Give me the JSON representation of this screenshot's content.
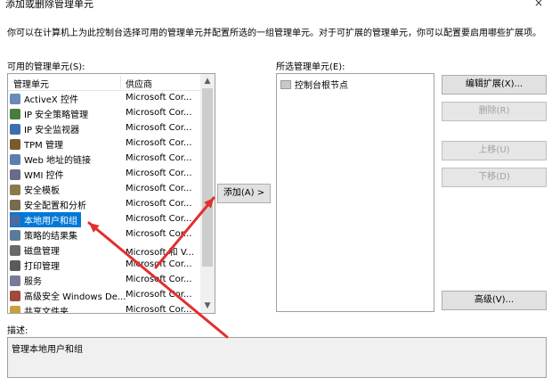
{
  "window": {
    "title": "添加或删除管理单元",
    "close_glyph": "×"
  },
  "instruction": "你可以在计算机上为此控制台选择可用的管理单元并配置所选的一组管理单元。对于可扩展的管理单元，你可以配置要启用哪些扩展项。",
  "available": {
    "label": "可用的管理单元(S):",
    "col_name": "管理单元",
    "col_vendor": "供应商",
    "items": [
      {
        "name": "ActiveX 控件",
        "vendor": "Microsoft Cor...",
        "icon": "activex-icon",
        "color": "#6a8bb5"
      },
      {
        "name": "IP 安全策略管理",
        "vendor": "Microsoft Cor...",
        "icon": "ip-policy-icon",
        "color": "#4a7d3a"
      },
      {
        "name": "IP 安全监视器",
        "vendor": "Microsoft Cor...",
        "icon": "ip-monitor-icon",
        "color": "#3a6fb0"
      },
      {
        "name": "TPM 管理",
        "vendor": "Microsoft Cor...",
        "icon": "tpm-icon",
        "color": "#7a5a2a"
      },
      {
        "name": "Web 地址的链接",
        "vendor": "Microsoft Cor...",
        "icon": "web-link-icon",
        "color": "#5a7fb0"
      },
      {
        "name": "WMI 控件",
        "vendor": "Microsoft Cor...",
        "icon": "wmi-icon",
        "color": "#6a6a8a"
      },
      {
        "name": "安全模板",
        "vendor": "Microsoft Cor...",
        "icon": "security-template-icon",
        "color": "#8a7a4a"
      },
      {
        "name": "安全配置和分析",
        "vendor": "Microsoft Cor...",
        "icon": "security-config-icon",
        "color": "#7a6a4a"
      },
      {
        "name": "本地用户和组",
        "vendor": "Microsoft Cor...",
        "icon": "local-users-icon",
        "color": "#4a6aa0"
      },
      {
        "name": "策略的结果集",
        "vendor": "Microsoft Cor...",
        "icon": "rsop-icon",
        "color": "#5a7a9a"
      },
      {
        "name": "磁盘管理",
        "vendor": "Microsoft 和 V...",
        "icon": "disk-icon",
        "color": "#6a6a6a"
      },
      {
        "name": "打印管理",
        "vendor": "Microsoft Cor...",
        "icon": "print-icon",
        "color": "#5a5a5a"
      },
      {
        "name": "服务",
        "vendor": "Microsoft Cor...",
        "icon": "services-icon",
        "color": "#7a7a9a"
      },
      {
        "name": "高级安全 Windows De...",
        "vendor": "Microsoft Cor...",
        "icon": "firewall-icon",
        "color": "#a04a3a"
      },
      {
        "name": "共享文件夹",
        "vendor": "Microsoft Cor...",
        "icon": "shared-folder-icon",
        "color": "#c8a040"
      }
    ],
    "selected_index": 8
  },
  "add_button": "添加(A) >",
  "selected": {
    "label": "所选管理单元(E):",
    "items": [
      {
        "name": "控制台根节点",
        "icon": "folder-icon"
      }
    ]
  },
  "buttons": {
    "edit_ext": "编辑扩展(X)...",
    "remove": "删除(R)",
    "move_up": "上移(U)",
    "move_down": "下移(D)",
    "advanced": "高级(V)..."
  },
  "description": {
    "label": "描述:",
    "text": "管理本地用户和组"
  },
  "annotation_color": "#e03030"
}
